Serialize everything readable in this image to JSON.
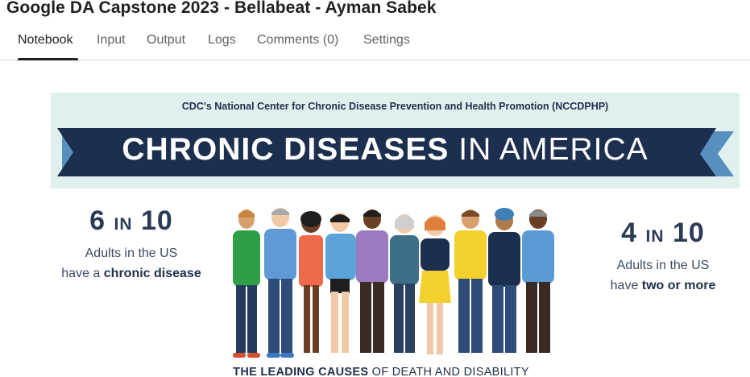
{
  "page": {
    "title": "Google DA Capstone 2023 - Bellabeat - Ayman Sabek"
  },
  "tabs": [
    {
      "label": "Notebook",
      "active": true
    },
    {
      "label": "Input"
    },
    {
      "label": "Output"
    },
    {
      "label": "Logs"
    },
    {
      "label": "Comments (0)"
    },
    {
      "label": "Settings"
    }
  ],
  "infographic": {
    "subtitle": "CDC's National Center for Chronic Disease Prevention and Health Promotion (NCCDPHP)",
    "banner_bold": "CHRONIC DISEASES",
    "banner_light": "IN AMERICA",
    "left_stat": {
      "num_a": "6",
      "in_word": "IN",
      "num_b": "10",
      "line1": "Adults in the US",
      "line2_pre": "have a ",
      "line2_bold": "chronic disease"
    },
    "right_stat": {
      "num_a": "4",
      "in_word": "IN",
      "num_b": "10",
      "line1": "Adults in the US",
      "line2_pre": "have ",
      "line2_bold": "two or more"
    },
    "bottom_bold": "THE LEADING CAUSES",
    "bottom_rest": " OF DEATH AND DISABILITY",
    "colors": {
      "banner_bg": "#dff0ef",
      "ribbon": "#1c2f4f",
      "ribbon_tail": "#3f7fb5"
    }
  }
}
